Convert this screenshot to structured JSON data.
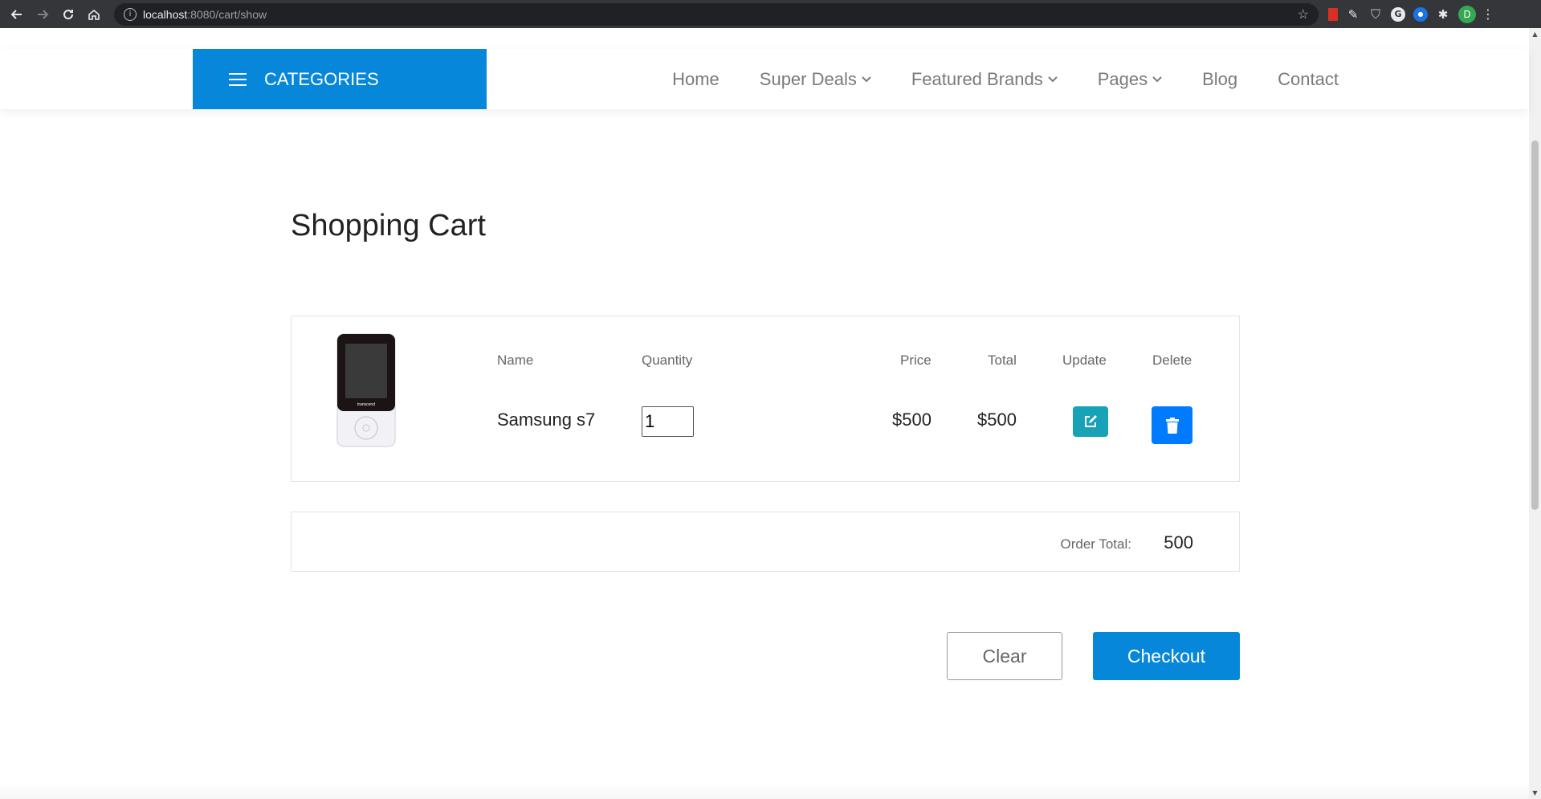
{
  "browser": {
    "url_host": "localhost",
    "url_path": ":8080/cart/show",
    "profile_initial": "D"
  },
  "header": {
    "categories_label": "CATEGORIES",
    "nav": {
      "home": "Home",
      "super_deals": "Super Deals",
      "featured_brands": "Featured Brands",
      "pages": "Pages",
      "blog": "Blog",
      "contact": "Contact"
    }
  },
  "page": {
    "title": "Shopping Cart"
  },
  "cart": {
    "columns": {
      "name": "Name",
      "quantity": "Quantity",
      "price": "Price",
      "total": "Total",
      "update": "Update",
      "delete": "Delete"
    },
    "items": [
      {
        "name": "Samsung s7",
        "quantity": "1",
        "price": "$500",
        "total": "$500",
        "product_logo_text": "transcend"
      }
    ],
    "order_total_label": "Order Total:",
    "order_total_value": "500"
  },
  "actions": {
    "clear_label": "Clear",
    "checkout_label": "Checkout"
  },
  "colors": {
    "primary": "#0787d9",
    "update_button": "#17a2b8",
    "delete_button": "#007bff"
  }
}
